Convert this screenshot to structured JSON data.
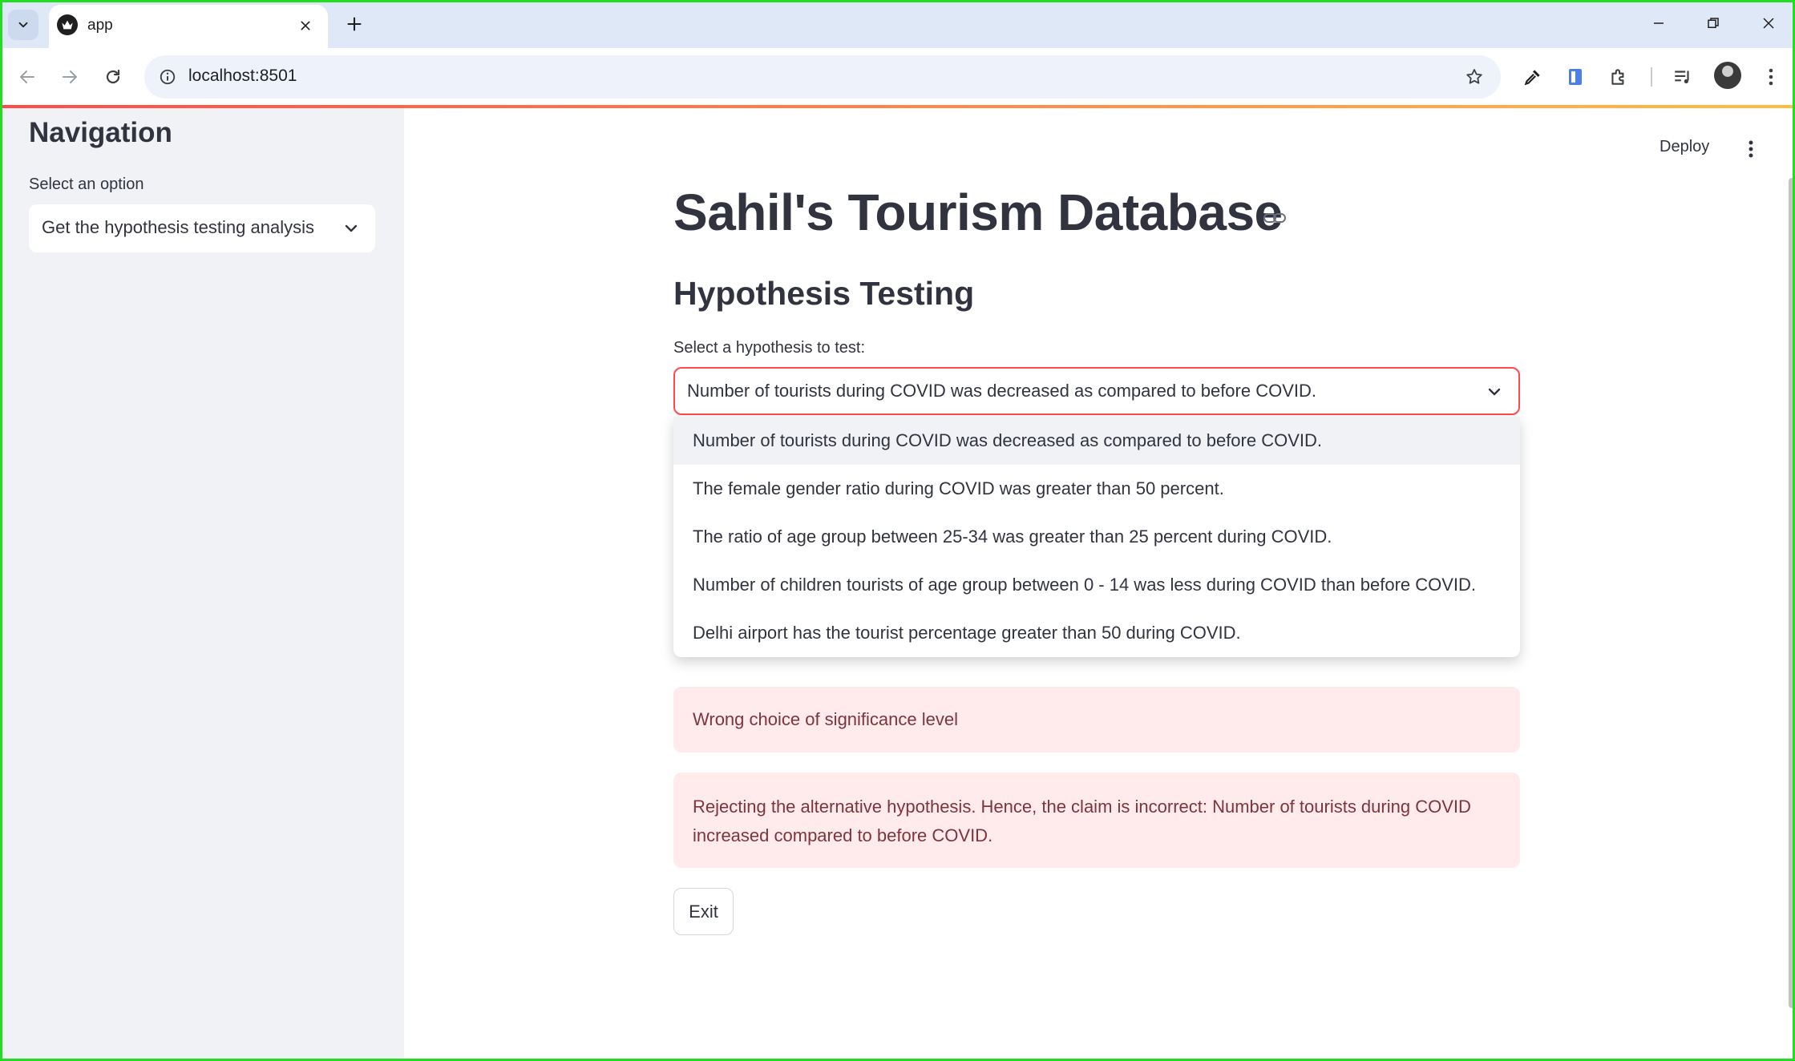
{
  "browser": {
    "tab_title": "app",
    "url": "localhost:8501"
  },
  "sidebar": {
    "title": "Navigation",
    "select_label": "Select an option",
    "select_value": "Get the hypothesis testing analysis"
  },
  "header": {
    "deploy_label": "Deploy"
  },
  "main": {
    "title": "Sahil's Tourism Database",
    "section_title": "Hypothesis Testing",
    "hypothesis_label": "Select a hypothesis to test:",
    "hypothesis_value": "Number of tourists during COVID was decreased as compared to before COVID.",
    "options": [
      "Number of tourists during COVID was decreased as compared to before COVID.",
      "The female gender ratio during COVID was greater than 50 percent.",
      "The ratio of age group between 25-34 was greater than 25 percent during COVID.",
      "Number of children tourists of age group between 0 - 14 was less during COVID than before COVID.",
      "Delhi airport has the tourist percentage greater than 50 during COVID."
    ],
    "alert_1": "Wrong choice of significance level",
    "alert_2": "Rejecting the alternative hypothesis. Hence, the claim is incorrect: Number of tourists during COVID increased compared to before COVID.",
    "exit_label": "Exit"
  },
  "colors": {
    "accent": "#ff4b4b",
    "error_bg": "#ffebec",
    "error_text": "#7d353b",
    "sidebar_bg": "#f0f2f6"
  }
}
